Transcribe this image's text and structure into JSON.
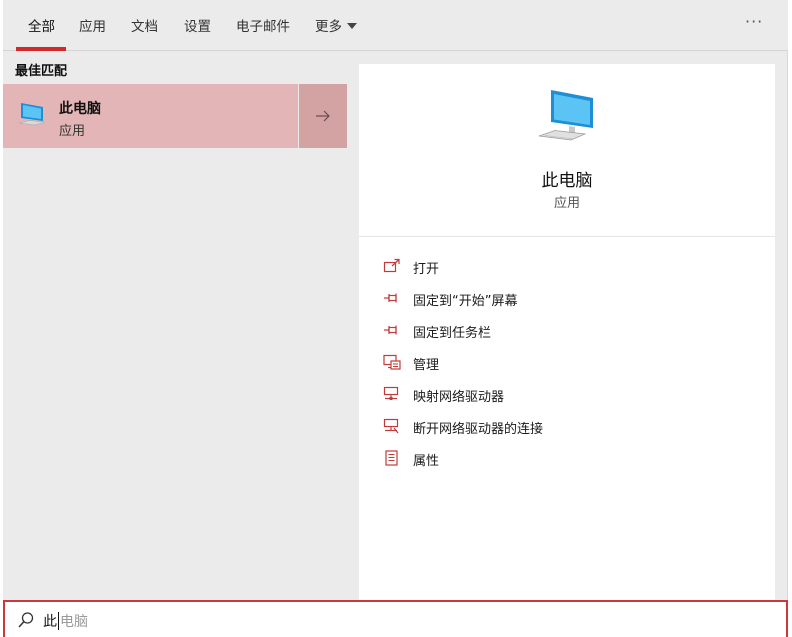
{
  "tabs": [
    {
      "label": "全部",
      "active": true
    },
    {
      "label": "应用"
    },
    {
      "label": "文档"
    },
    {
      "label": "设置"
    },
    {
      "label": "电子邮件"
    },
    {
      "label": "更多"
    }
  ],
  "overflow_menu": "···",
  "best_match": {
    "heading": "最佳匹配",
    "title": "此电脑",
    "subtitle": "应用"
  },
  "detail": {
    "title": "此电脑",
    "subtitle": "应用",
    "actions": [
      {
        "label": "打开",
        "icon": "open-icon"
      },
      {
        "label": "固定到“开始”屏幕",
        "icon": "pin-icon"
      },
      {
        "label": "固定到任务栏",
        "icon": "pin-icon"
      },
      {
        "label": "管理",
        "icon": "manage-icon"
      },
      {
        "label": "映射网络驱动器",
        "icon": "network-drive-icon"
      },
      {
        "label": "断开网络驱动器的连接",
        "icon": "network-drive-icon"
      },
      {
        "label": "属性",
        "icon": "properties-icon"
      }
    ]
  },
  "search": {
    "typed": "此",
    "suggestion": "电脑"
  },
  "colors": {
    "accent": "#d22a2a",
    "selection": "#e3b5b6",
    "icon_red": "#c23b3b"
  }
}
